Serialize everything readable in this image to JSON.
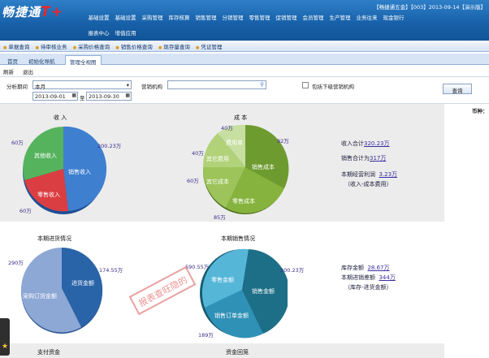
{
  "header": {
    "logo": "畅捷通",
    "logo_suffix": "T+",
    "info": "【畅捷通五金】【003】2013-09-14【演示版】",
    "menu": [
      "基础设置",
      "基础设置",
      "采购管理",
      "库存核算",
      "销售管理",
      "分销管理",
      "零售管理",
      "促销管理",
      "会员管理",
      "生产管理",
      "业务往来",
      "现金银行",
      "报表中心",
      "增值应用"
    ]
  },
  "quicklinks": [
    "单据查询",
    "待审核业务",
    "采购价格查询",
    "销售价格查询",
    "现存量查询",
    "凭证管理"
  ],
  "tabs": [
    "首页",
    "初始化导航",
    "管理全视图"
  ],
  "actions": {
    "refresh": "刷新",
    "exit": "退出"
  },
  "filters": {
    "period_label": "分析期间",
    "period_value": "本月",
    "date_from": "2013-09-01",
    "date_to_sep": "至",
    "date_to": "2013-09-30",
    "org_label": "营销机构",
    "org_value": "",
    "include_sub": "包括下级营销机构",
    "query_button": "查询",
    "currency_label": "币种："
  },
  "charts": {
    "income": {
      "title": "收 入",
      "labels": [
        "销售收入",
        "零售收入",
        "其他收入"
      ],
      "values": [
        "200.23万",
        "60万",
        "60万"
      ]
    },
    "cost": {
      "title": "成 本",
      "labels": [
        "销售成本",
        "零售成本",
        "其它成本",
        "其它费用",
        "费用单"
      ],
      "values": [
        "92万",
        "85万",
        "60万",
        "40万",
        "40万"
      ]
    },
    "purchase": {
      "title": "本期进货情况",
      "labels": [
        "进货金额",
        "采购订货金额"
      ],
      "values": [
        "174.55万",
        "290万"
      ]
    },
    "sales": {
      "title": "本期销售情况",
      "labels": [
        "销售金额",
        "销售订单金额",
        "零售金额"
      ],
      "values": [
        "200.23万",
        "189万",
        "590.55万"
      ]
    },
    "bottom_titles": [
      "支付资金",
      "资金回笼"
    ]
  },
  "summary1": {
    "income_total_label": "收入合计",
    "income_total": "320.23万",
    "sales_total_label": "销售合计为",
    "sales_total": "317万",
    "profit_label": "本期经营利润",
    "profit": "3.23万",
    "profit_note": "（收入-成本费用）"
  },
  "summary2": {
    "inventory_label": "库存金额",
    "inventory": "28.67万",
    "diff_label": "本期进销差额",
    "diff": "344万",
    "diff_note": "（库存-进货金额）"
  },
  "stamp": "报表查旺隐的",
  "colors": {
    "blue": "#2f71c8",
    "red": "#d8373b",
    "green": "#4dab56",
    "olive": "#6e9b30",
    "teal": "#2e8fb4"
  }
}
